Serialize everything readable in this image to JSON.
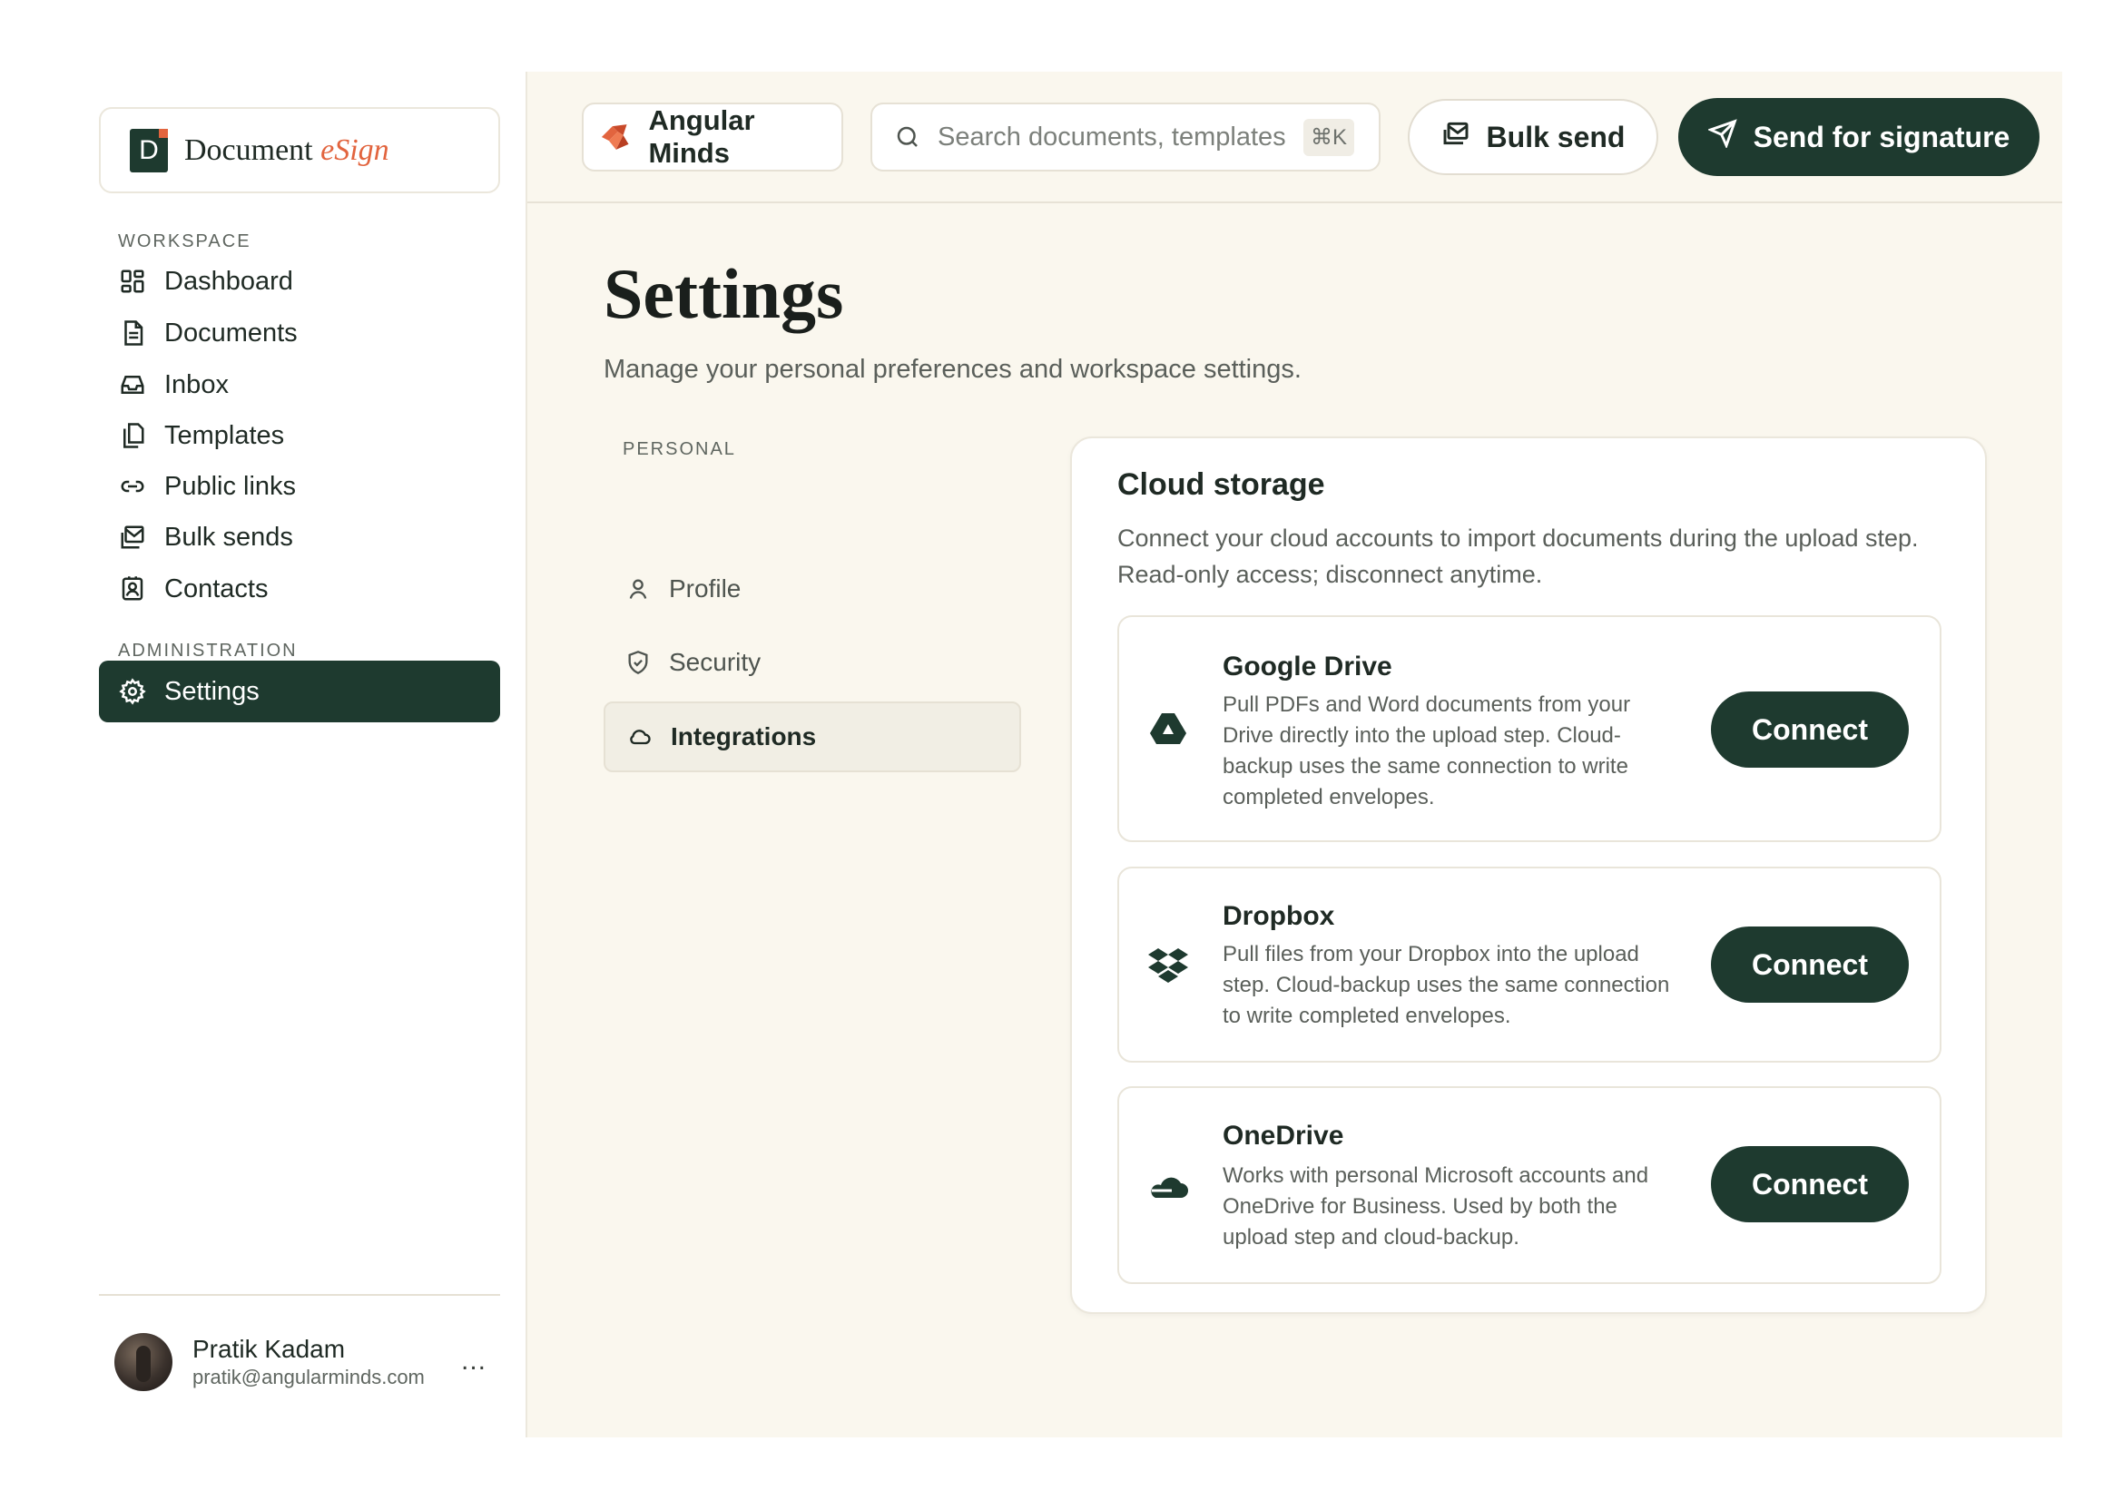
{
  "brand": {
    "mark": "D",
    "name": "Document",
    "accent": "eSign"
  },
  "sidebar": {
    "workspace_label": "WORKSPACE",
    "items": [
      {
        "label": "Dashboard",
        "icon": "dashboard-icon"
      },
      {
        "label": "Documents",
        "icon": "document-icon"
      },
      {
        "label": "Inbox",
        "icon": "inbox-icon"
      },
      {
        "label": "Templates",
        "icon": "templates-icon"
      },
      {
        "label": "Public links",
        "icon": "link-icon"
      },
      {
        "label": "Bulk sends",
        "icon": "bulk-send-icon"
      },
      {
        "label": "Contacts",
        "icon": "contacts-icon"
      }
    ],
    "admin_label": "ADMINISTRATION",
    "settings_label": "Settings"
  },
  "user": {
    "name": "Pratik Kadam",
    "email": "pratik@angularminds.com",
    "more": "..."
  },
  "topbar": {
    "org_name": "Angular Minds",
    "search_placeholder": "Search documents, templates",
    "search_shortcut": "⌘K",
    "bulk_send_label": "Bulk send",
    "send_for_signature_label": "Send for signature"
  },
  "page": {
    "title": "Settings",
    "subtitle": "Manage your personal preferences and workspace settings."
  },
  "settings_nav": {
    "section_label": "PERSONAL",
    "items": [
      {
        "label": "Profile",
        "icon": "user-icon"
      },
      {
        "label": "Security",
        "icon": "shield-icon"
      },
      {
        "label": "Integrations",
        "icon": "cloud-icon",
        "active": true
      }
    ]
  },
  "cloud_storage": {
    "title": "Cloud storage",
    "description": "Connect your cloud accounts to import documents during the upload step. Read-only access; disconnect anytime.",
    "providers": [
      {
        "name": "Google Drive",
        "icon": "google-drive-icon",
        "description": "Pull PDFs and Word documents from your Drive directly into the upload step. Cloud-backup uses the same connection to write completed envelopes.",
        "action": "Connect"
      },
      {
        "name": "Dropbox",
        "icon": "dropbox-icon",
        "description": "Pull files from your Dropbox into the upload step. Cloud-backup uses the same connection to write completed envelopes.",
        "action": "Connect"
      },
      {
        "name": "OneDrive",
        "icon": "onedrive-icon",
        "description": "Works with personal Microsoft accounts and OneDrive for Business. Used by both the upload step and cloud-backup.",
        "action": "Connect"
      }
    ]
  },
  "colors": {
    "primary": "#1e3a2f",
    "accent": "#e2643e",
    "background": "#faf7ee"
  }
}
